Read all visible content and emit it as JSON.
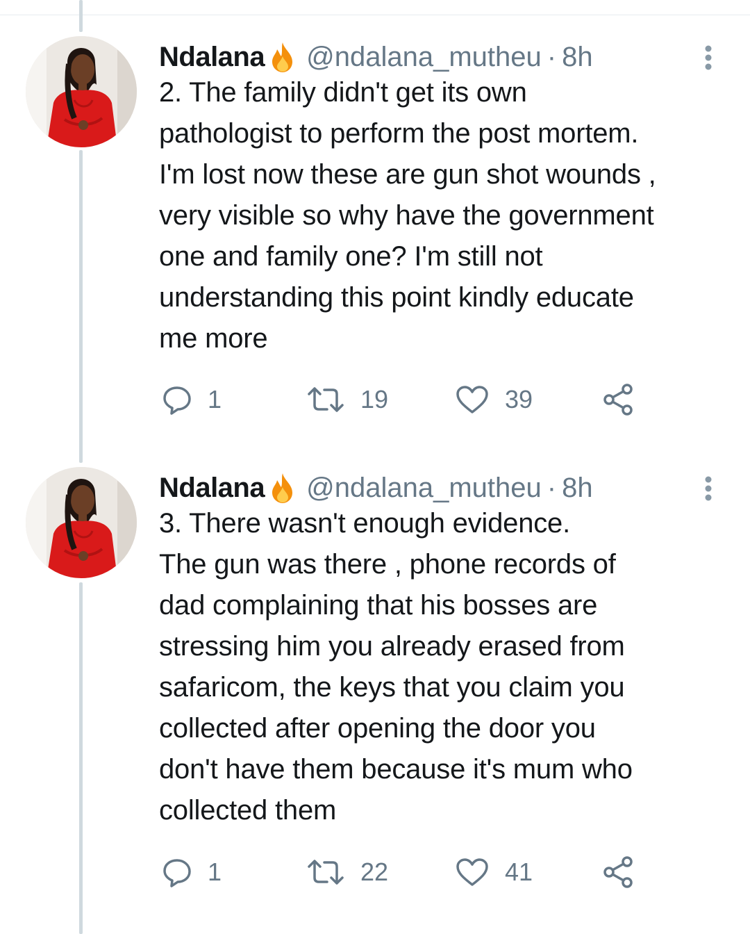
{
  "tweets": [
    {
      "author": {
        "name": "Ndalana",
        "badge_icon": "fire-icon",
        "handle": "@ndalana_mutheu",
        "separator": "·",
        "time": "8h"
      },
      "text": "2. The family didn't get its own\npathologist to perform the post mortem.\nI'm lost now these are gun shot wounds ,\nvery visible so why have the government\none and family one? I'm still not\nunderstanding this point kindly educate\nme more",
      "actions": {
        "replies": "1",
        "retweets": "19",
        "likes": "39"
      }
    },
    {
      "author": {
        "name": "Ndalana",
        "badge_icon": "fire-icon",
        "handle": "@ndalana_mutheu",
        "separator": "·",
        "time": "8h"
      },
      "text": "3. There wasn't enough evidence.\nThe gun was there , phone records of\ndad complaining that his bosses are\nstressing him you already erased from\nsafaricom, the keys that you claim you\ncollected after opening the door you\ndon't have them because it's mum who\ncollected them",
      "actions": {
        "replies": "1",
        "retweets": "22",
        "likes": "41"
      }
    }
  ],
  "colors": {
    "text": "#14171a",
    "secondary": "#657786",
    "thread_line": "#cfd9de",
    "divider": "#e6ecf0",
    "fire_outer": "#f4900c",
    "fire_inner": "#ffcc4d"
  }
}
